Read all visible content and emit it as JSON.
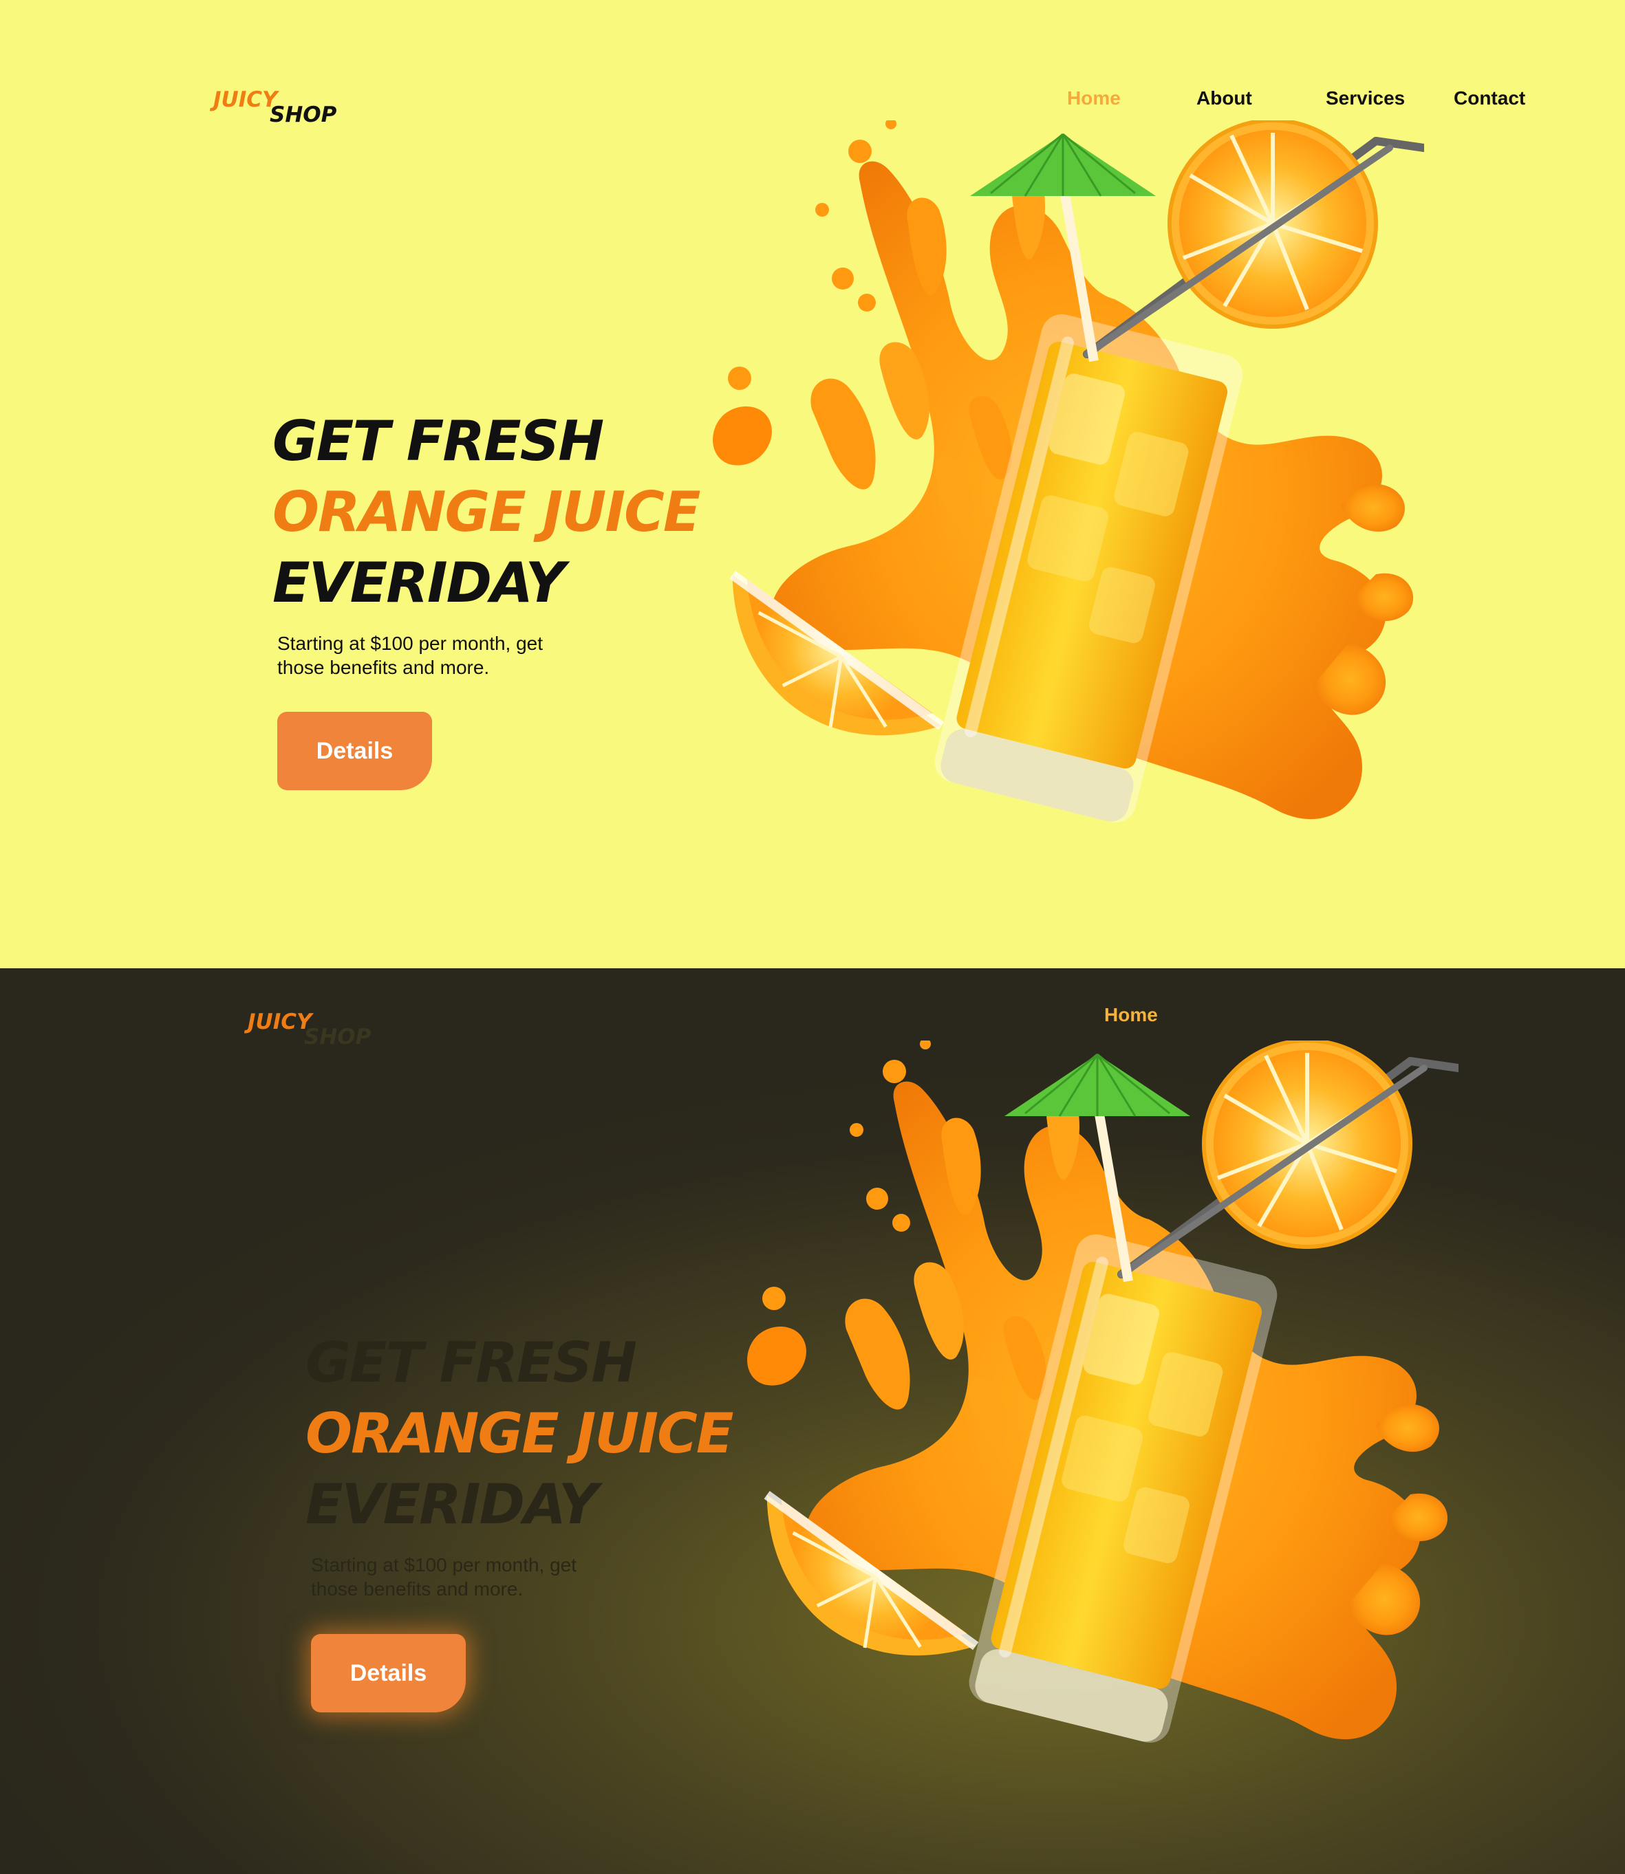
{
  "light": {
    "logo": {
      "word1": "JUICY",
      "word2": "SHOP"
    },
    "nav": {
      "home": "Home",
      "about": "About",
      "services": "Services",
      "contact": "Contact"
    },
    "hero": {
      "line1": "GET FRESH",
      "line2": "ORANGE JUICE",
      "line3": "EVERIDAY",
      "subtitle_line1": "Starting at $100 per month, get",
      "subtitle_line2": "those benefits and more.",
      "button": "Details"
    }
  },
  "dark": {
    "logo": {
      "word1": "JUICY",
      "word2": "SHOP"
    },
    "nav": {
      "home": "Home"
    },
    "hero": {
      "line1": "GET FRESH",
      "line2": "ORANGE JUICE",
      "line3": "EVERIDAY",
      "subtitle_line1": "Starting at $100 per month, get",
      "subtitle_line2": "those benefits and more.",
      "button": "Details"
    }
  },
  "colors": {
    "light_bg": "#f9f97e",
    "accent_orange": "#f07c14",
    "button_orange": "#f0843a",
    "nav_active": "#f5a83c",
    "dark_bg": "#2d2a1d",
    "umbrella_green": "#5cc63a"
  },
  "illustration": {
    "icon": "orange-juice-glass-with-splash",
    "elements": [
      "orange-slice",
      "orange-wedge",
      "drinking-straw",
      "cocktail-umbrella",
      "juice-splash"
    ]
  }
}
